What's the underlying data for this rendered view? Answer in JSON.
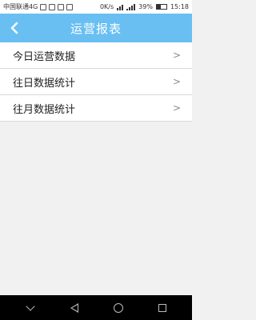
{
  "status_bar": {
    "carrier": "中国联通4G",
    "speed": "0K/s",
    "battery": "39%",
    "time": "15:18"
  },
  "header": {
    "back_icon": "chevron-left-icon",
    "title": "运营报表"
  },
  "menu": {
    "items": [
      {
        "label": "今日运营数据"
      },
      {
        "label": "往日数据统计"
      },
      {
        "label": "往月数据统计"
      }
    ]
  },
  "colors": {
    "header_bg": "#69bff2",
    "page_bg": "#f1f1f1"
  }
}
